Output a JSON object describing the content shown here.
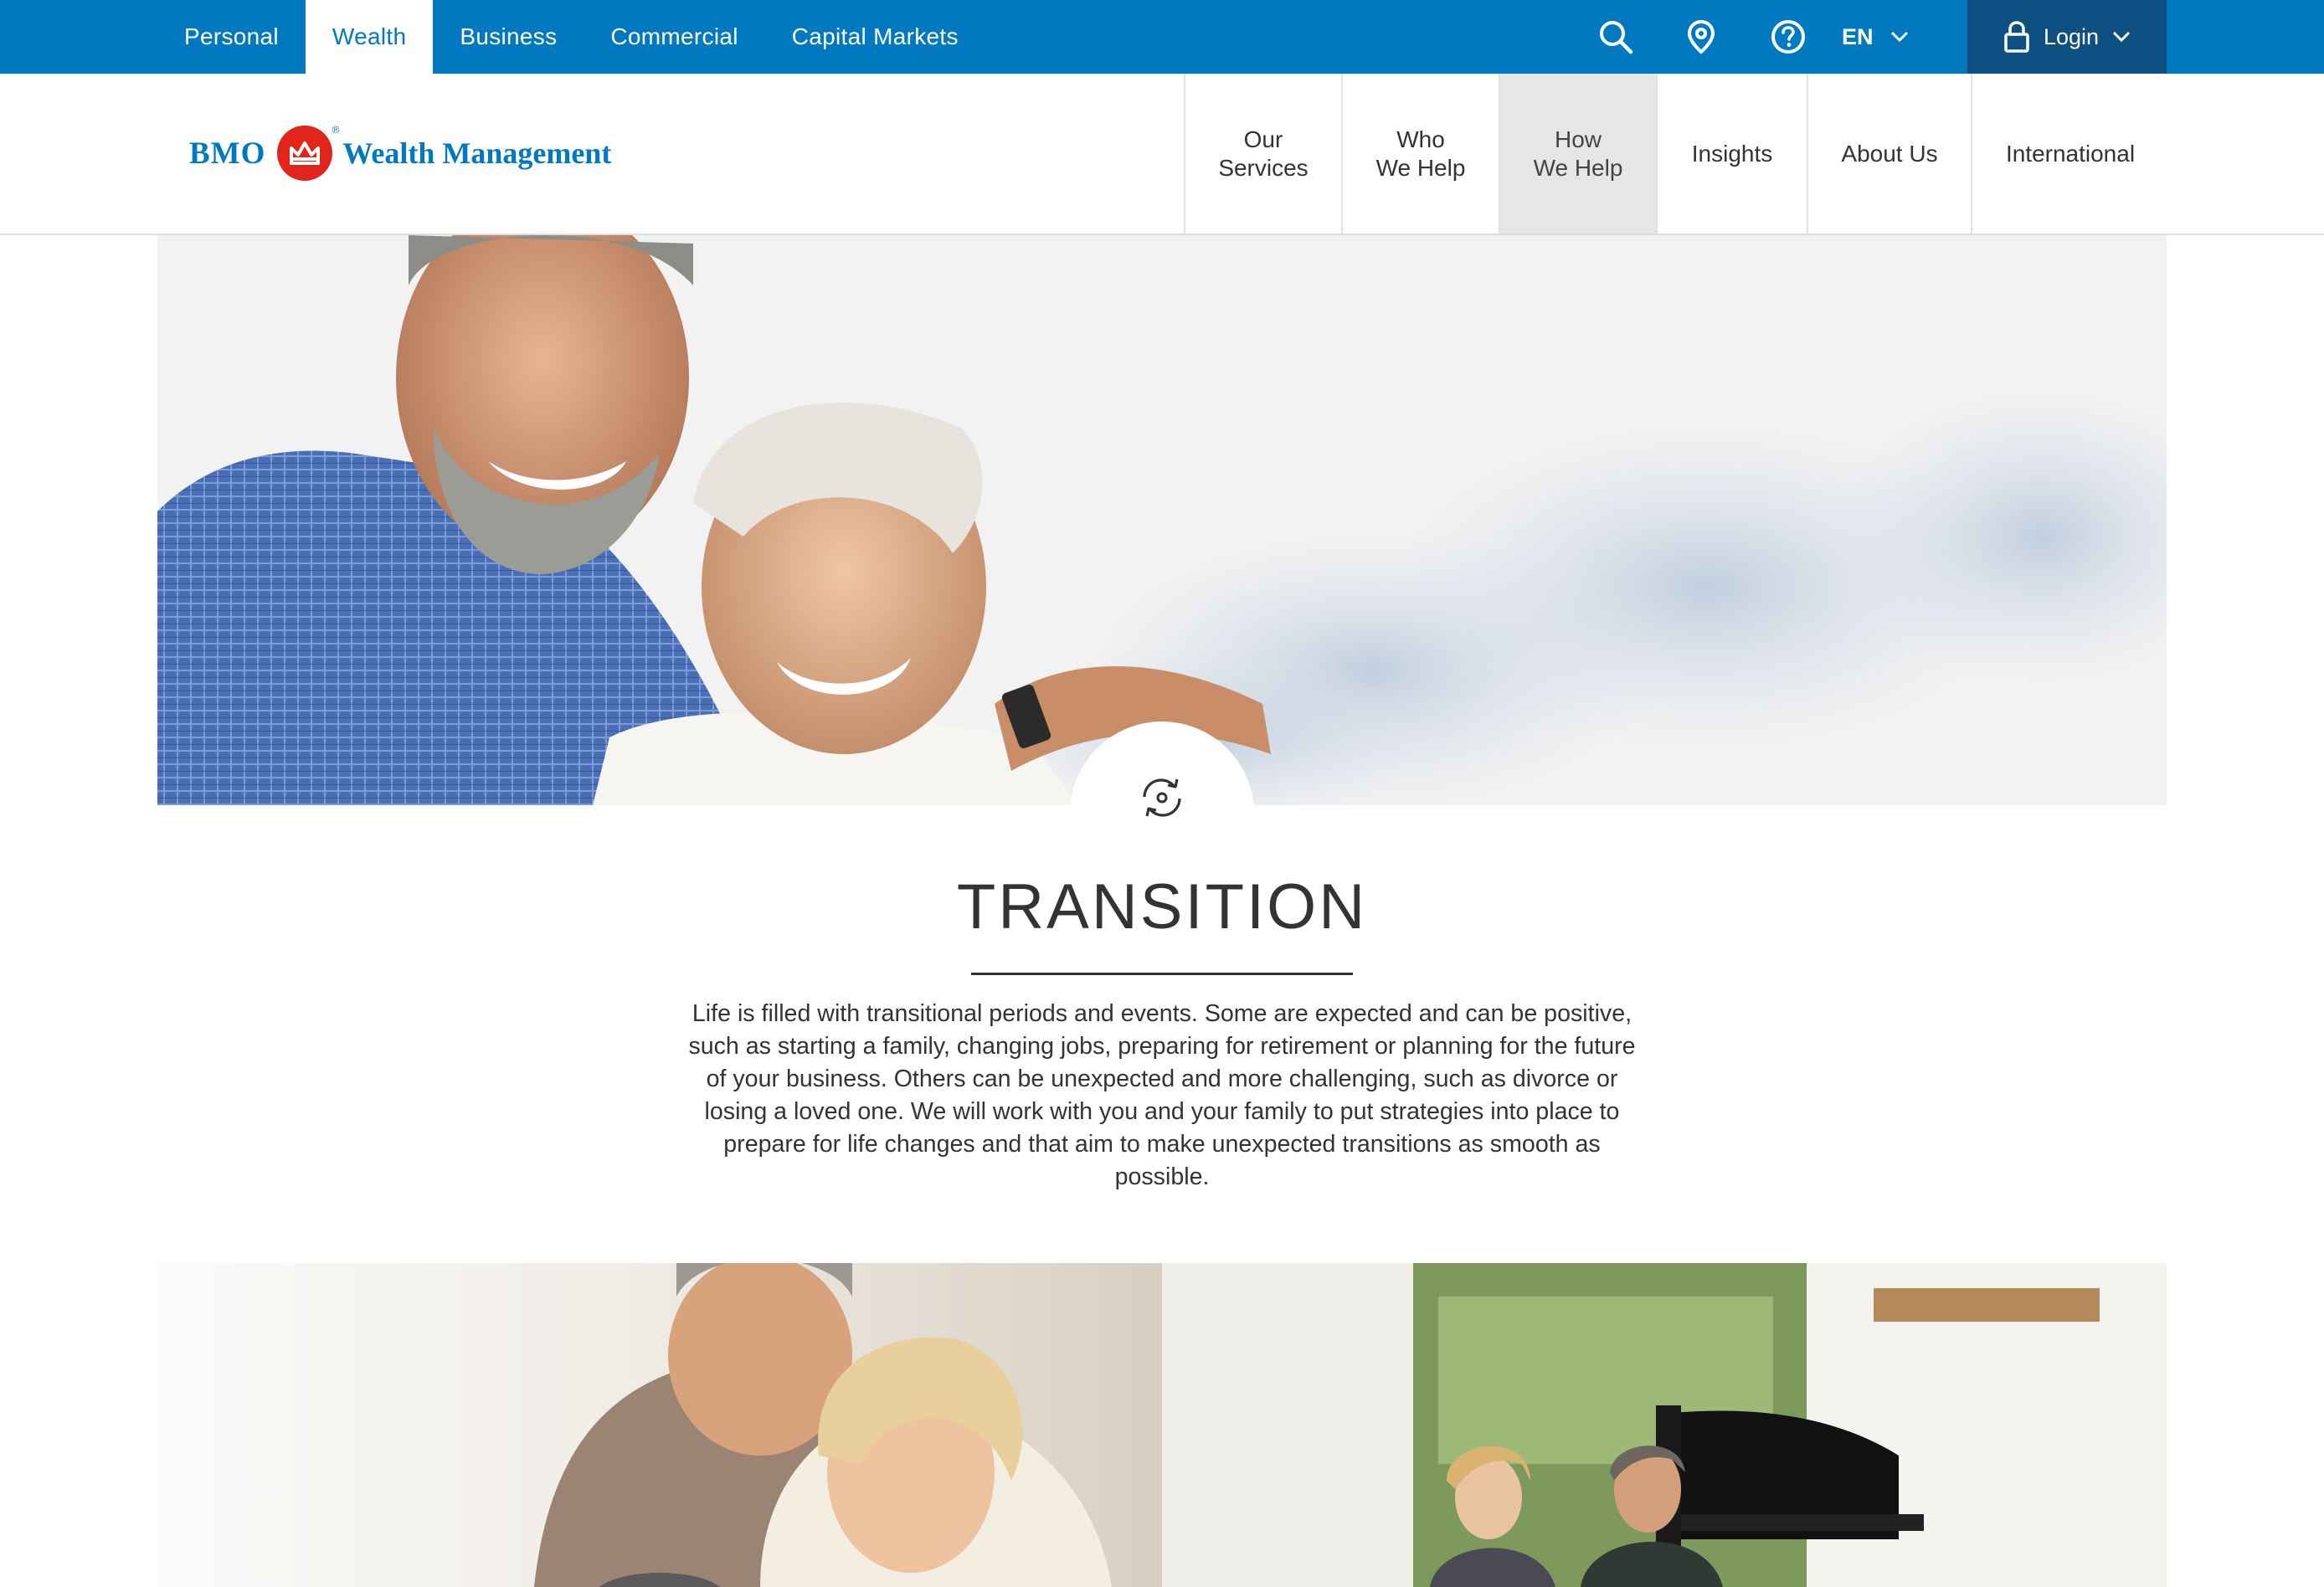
{
  "topnav": {
    "items": [
      {
        "label": "Personal",
        "active": false
      },
      {
        "label": "Wealth",
        "active": true
      },
      {
        "label": "Business",
        "active": false
      },
      {
        "label": "Commercial",
        "active": false
      },
      {
        "label": "Capital Markets",
        "active": false
      }
    ],
    "icons": [
      "search-icon",
      "location-pin-icon",
      "help-icon"
    ],
    "language": "EN",
    "login_label": "Login"
  },
  "brand": {
    "bmo": "BMO",
    "name": "Wealth Management",
    "registered": "®",
    "colors": {
      "blue": "#0079c1",
      "red": "#e1251b",
      "navy": "#0d4f80"
    }
  },
  "mainnav": {
    "items": [
      {
        "line1": "Our",
        "line2": "Services",
        "active": false
      },
      {
        "line1": "Who",
        "line2": "We Help",
        "active": false
      },
      {
        "line1": "How",
        "line2": "We Help",
        "active": true
      },
      {
        "line1": "Insights",
        "line2": "",
        "active": false
      },
      {
        "line1": "About Us",
        "line2": "",
        "active": false
      },
      {
        "line1": "International",
        "line2": "",
        "active": false
      }
    ]
  },
  "hero": {
    "badge_icon": "transition-cycle-icon"
  },
  "section": {
    "title": "TRANSITION",
    "body": "Life is filled with transitional periods and events. Some are expected and can be positive, such as starting a family, changing jobs, preparing for retirement or planning for the future of your business. Others can be unexpected and more challenging, such as divorce or losing a loved one. We will work with you and your family to put strategies into place to prepare for life changes and that aim to make unexpected transitions as smooth as possible."
  }
}
